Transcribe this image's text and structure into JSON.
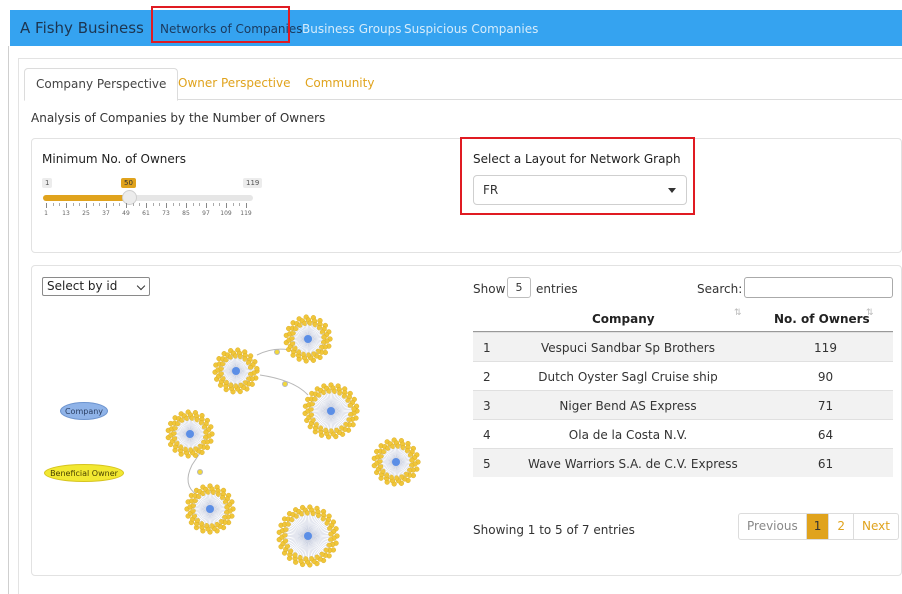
{
  "navbar": {
    "brand": "A Fishy Business",
    "links": [
      "Networks of Companies",
      "Business Groups",
      "Suspicious Companies"
    ]
  },
  "tabs": [
    "Company Perspective",
    "Owner Perspective",
    "Community"
  ],
  "subtitle": "Analysis of Companies by the Number of Owners",
  "slider": {
    "label": "Minimum No. of Owners",
    "min": 1,
    "max": 119,
    "value": 50,
    "min_label": "1",
    "max_label": "119",
    "value_label": "50",
    "tick_labels": [
      "1",
      "13",
      "25",
      "37",
      "49",
      "61",
      "73",
      "85",
      "97",
      "109",
      "119"
    ]
  },
  "layout_select": {
    "label": "Select a Layout for Network Graph",
    "value": "FR"
  },
  "node_select": {
    "value": "Select by id"
  },
  "legend": {
    "company": "Company",
    "owner": "Beneficial Owner"
  },
  "table": {
    "show_label": "Show",
    "entries_value": "5",
    "entries_label": "entries",
    "search_label": "Search:",
    "headers": [
      "Company",
      "No. of Owners"
    ],
    "rows": [
      {
        "idx": "1",
        "company": "Vespuci Sandbar Sp Brothers",
        "owners": "119"
      },
      {
        "idx": "2",
        "company": "Dutch Oyster Sagl Cruise ship",
        "owners": "90"
      },
      {
        "idx": "3",
        "company": "Niger Bend AS Express",
        "owners": "71"
      },
      {
        "idx": "4",
        "company": "Ola de la Costa N.V.",
        "owners": "64"
      },
      {
        "idx": "5",
        "company": "Wave Warriors S.A. de C.V. Express",
        "owners": "61"
      }
    ],
    "info": "Showing 1 to 5 of 7 entries",
    "pagination": {
      "previous": "Previous",
      "pages": [
        "1",
        "2"
      ],
      "next": "Next"
    }
  },
  "colors": {
    "navbar": "#35a3f0",
    "accent": "#e0a31d",
    "company_node": "#8fb3e8",
    "owner_node": "#f2d83a"
  }
}
